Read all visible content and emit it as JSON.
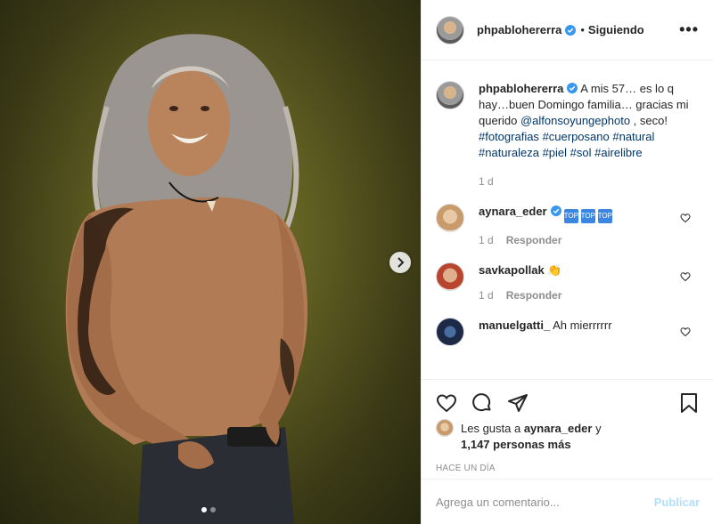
{
  "post": {
    "owner": "phpablohererra",
    "separator": "•",
    "follow_status": "Siguiendo",
    "more": "•••"
  },
  "caption": {
    "username": "phpablohererra",
    "text_1": " A mis 57… es lo q hay…buen Domingo familia… gracias mi querido ",
    "mention": "@alfonsoyungephoto",
    "text_2": " , seco! ",
    "tags": [
      "#fotografias",
      "#cuerposano",
      "#natural",
      "#naturaleza",
      "#piel",
      "#sol",
      "#airelibre"
    ],
    "time": "1 d"
  },
  "comments": [
    {
      "username": "aynara_eder",
      "text": "",
      "badges": [
        "TOP",
        "TOP",
        "TOP"
      ],
      "time": "1 d",
      "reply": "Responder"
    },
    {
      "username": "savkapollak",
      "text": "👏",
      "time": "1 d",
      "reply": "Responder"
    },
    {
      "username": "manuelgatti_",
      "text": "Ah mierrrrrr"
    }
  ],
  "likes": {
    "prefix": "Les gusta a ",
    "user": "aynara_eder",
    "middle": " y",
    "others": "1,147 personas más"
  },
  "date_label": "HACE UN DÍA",
  "add_comment": {
    "placeholder": "Agrega un comentario...",
    "post": "Publicar"
  },
  "colors": {
    "link": "#00376b",
    "verified": "#3897f0",
    "post_disabled": "#b2dffc"
  }
}
